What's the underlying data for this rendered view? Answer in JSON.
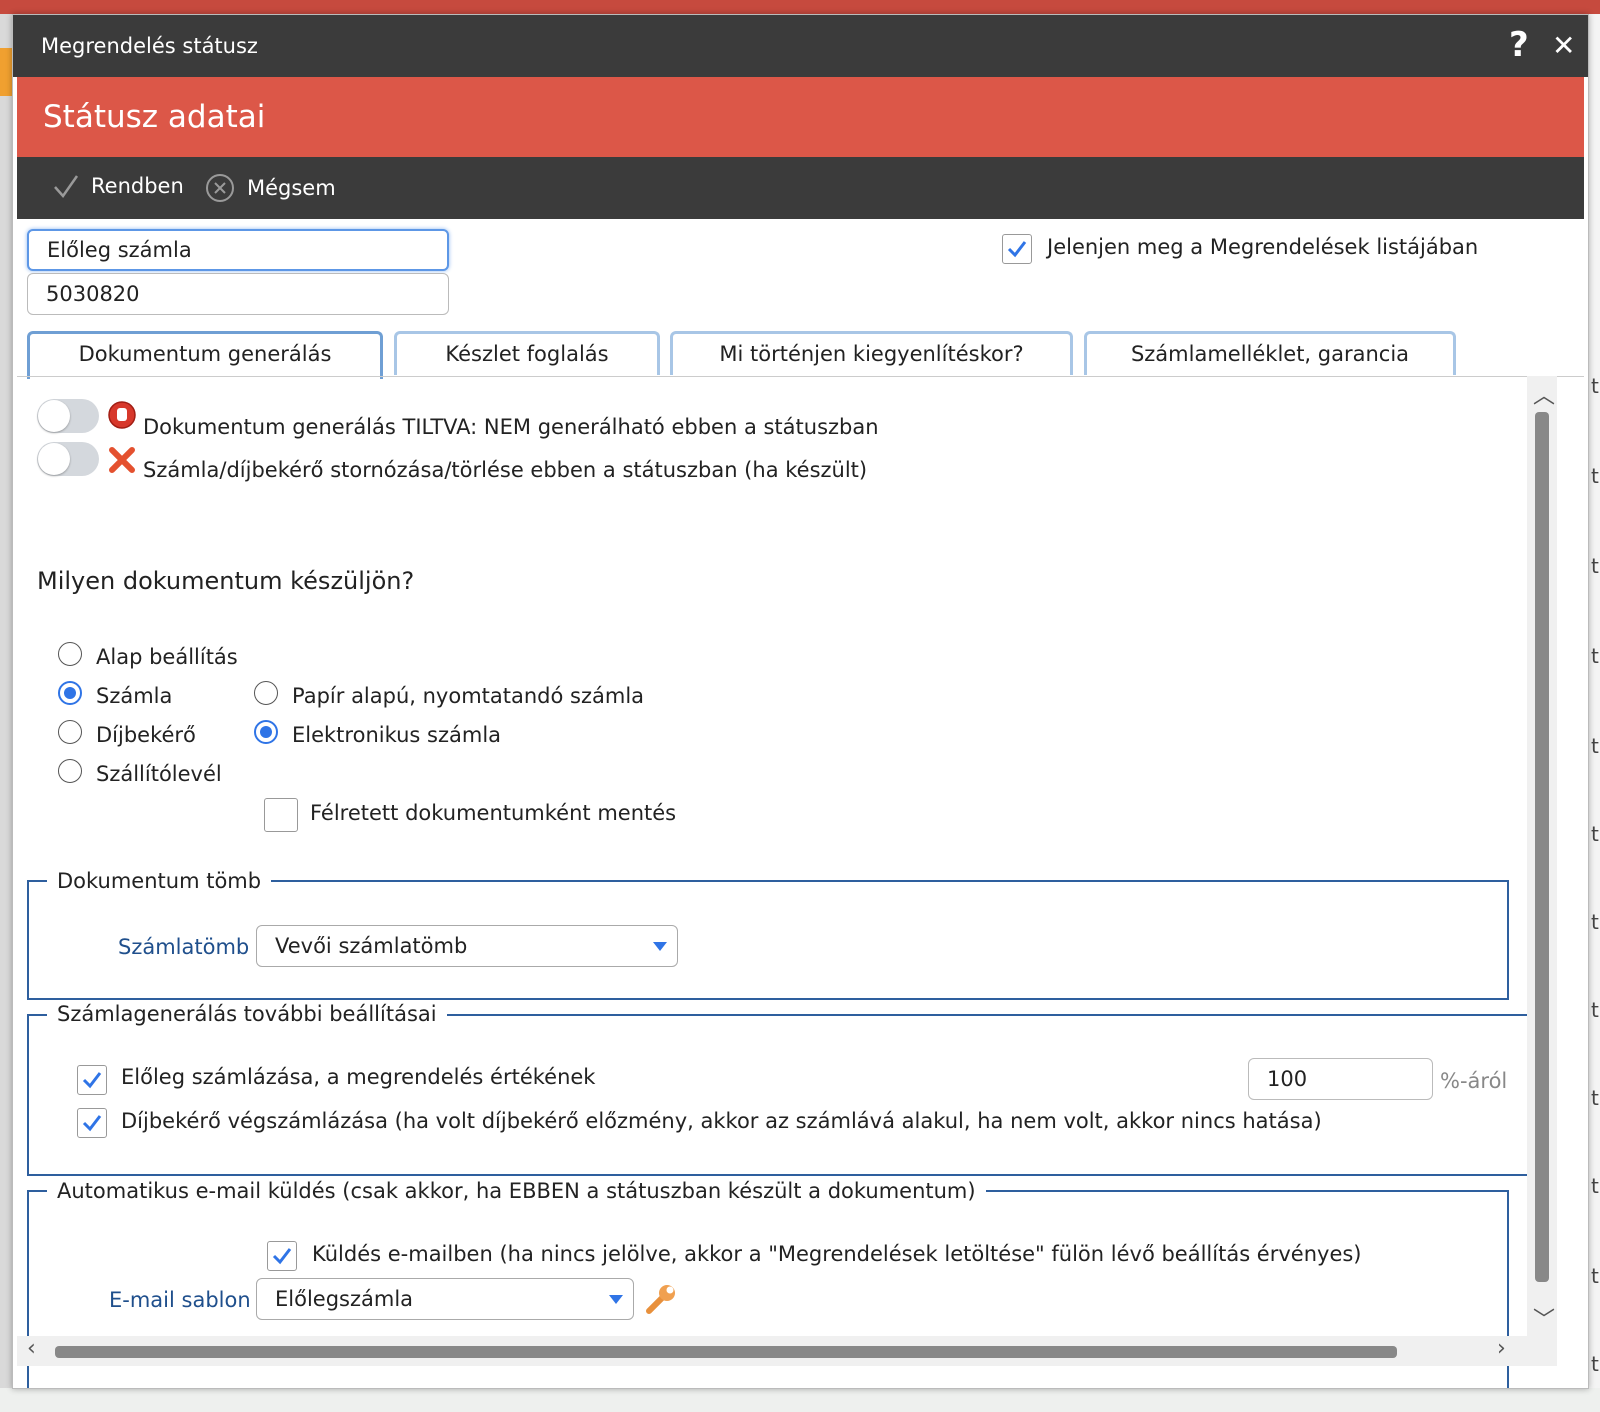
{
  "window": {
    "title": "Megrendelés státusz",
    "help_label": "?",
    "close_label": "✕"
  },
  "header": {
    "title": "Státusz adatai"
  },
  "toolbar": {
    "ok_label": "Rendben",
    "cancel_label": "Mégsem"
  },
  "fields": {
    "status_name": "Előleg számla",
    "status_code": "5030820",
    "show_in_list_label": "Jelenjen meg a Megrendelések listájában",
    "show_in_list_checked": true
  },
  "tabs": [
    {
      "label": "Dokumentum generálás",
      "active": true
    },
    {
      "label": "Készlet foglalás",
      "active": false
    },
    {
      "label": "Mi történjen kiegyenlítéskor?",
      "active": false
    },
    {
      "label": "Számlamelléklet, garancia",
      "active": false
    }
  ],
  "toggles": [
    {
      "label": "Dokumentum generálás TILTVA: NEM generálható ebben a státuszban",
      "on": false,
      "icon": "stop-hand-icon"
    },
    {
      "label": "Számla/díjbekérő stornózása/törlése ebben a státuszban (ha készült)",
      "on": false,
      "icon": "red-x-icon"
    }
  ],
  "doc_question": "Milyen dokumentum készüljön?",
  "doc_types": [
    {
      "label": "Alap beállítás",
      "selected": false
    },
    {
      "label": "Számla",
      "selected": true
    },
    {
      "label": "Díjbekérő",
      "selected": false
    },
    {
      "label": "Szállítólevél",
      "selected": false
    }
  ],
  "invoice_types": [
    {
      "label": "Papír alapú, nyomtatandó számla",
      "selected": false
    },
    {
      "label": "Elektronikus számla",
      "selected": true
    }
  ],
  "draft_save": {
    "label": "Félretett dokumentumként mentés",
    "checked": false
  },
  "doc_block": {
    "legend": "Dokumentum tömb",
    "field_label": "Számlatömb :",
    "value": "Vevői számlatömb"
  },
  "invoice_settings": {
    "legend": "Számlagenerálás további beállításai",
    "advance_label": "Előleg számlázása, a megrendelés értékének",
    "advance_checked": true,
    "advance_value": "100",
    "advance_suffix": "%-áról",
    "final_label": "Díjbekérő végszámlázása (ha volt díjbekérő előzmény, akkor az számlává alakul, ha nem volt, akkor nincs hatása)",
    "final_checked": true
  },
  "email": {
    "legend": "Automatikus e-mail küldés (csak akkor, ha EBBEN a státuszban készült a dokumentum)",
    "send_label": "Küldés e-mailben (ha nincs jelölve, akkor a \"Megrendelések letöltése\" fülön lévő beállítás érvényes)",
    "send_checked": true,
    "template_label": "E-mail sablon :",
    "template_value": "Előlegszámla"
  },
  "background": {
    "row_marker": "t"
  },
  "colors": {
    "accent_red": "#dc5748",
    "dark_bar": "#3b3b3b",
    "blue": "#2f74e6",
    "fieldset_border": "#2e5f9e"
  }
}
